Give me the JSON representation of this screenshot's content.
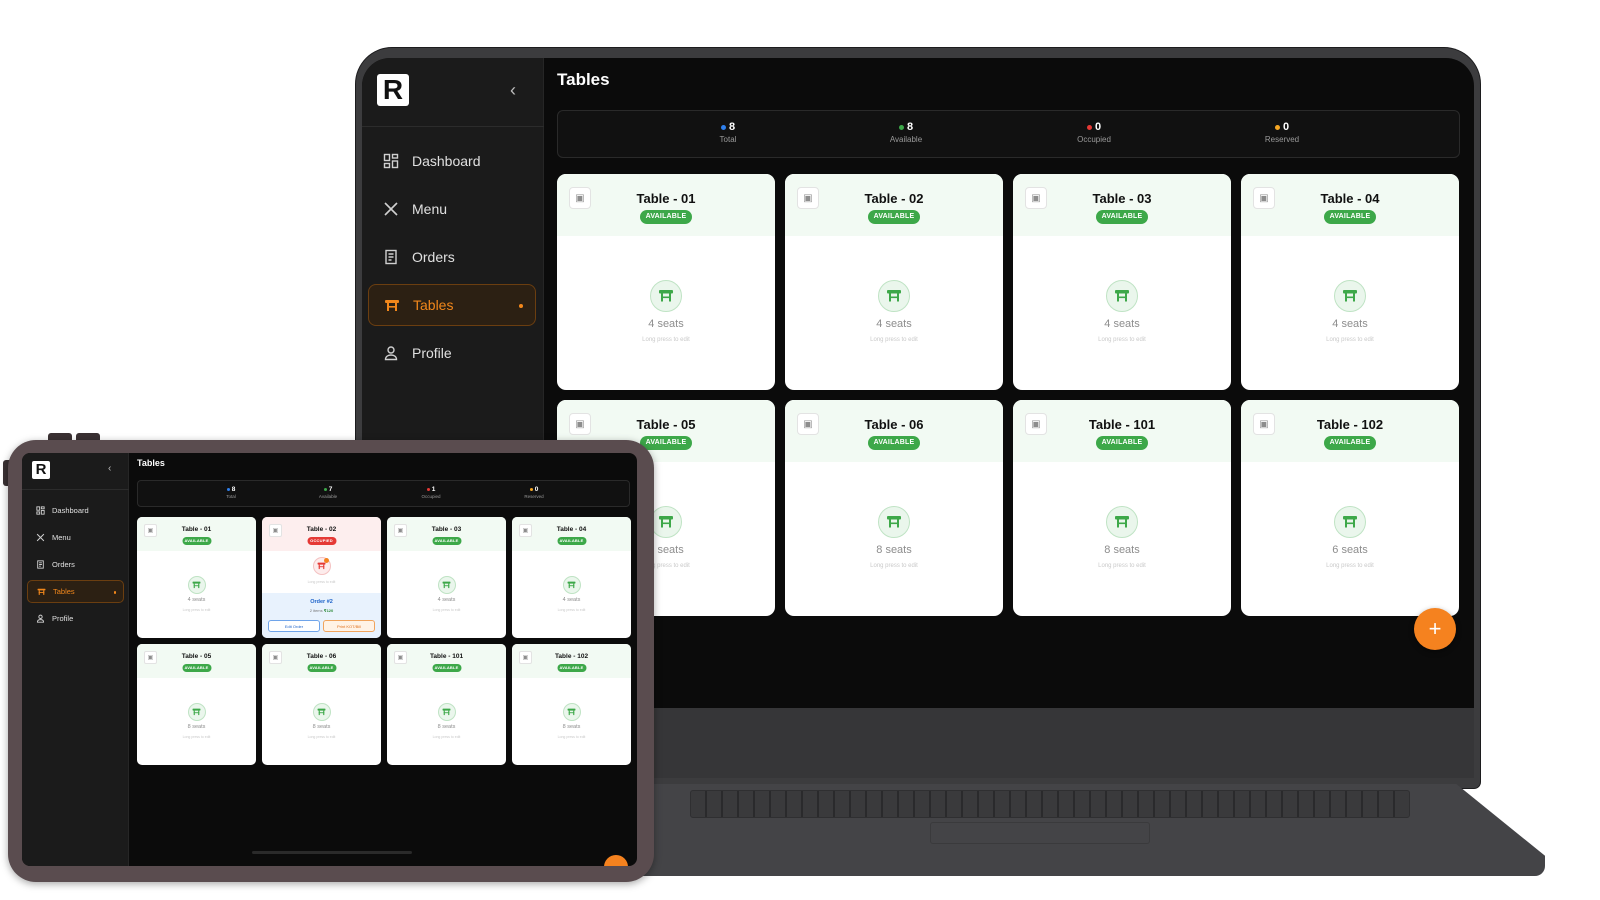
{
  "brand": {
    "logo_letter": "R",
    "accent": "#f5821f",
    "available_color": "#3da849",
    "occupied_color": "#e53935"
  },
  "laptop": {
    "sidebar": {
      "collapse_icon": "chevron-left-icon",
      "items": [
        {
          "label": "Dashboard",
          "icon": "grid-icon"
        },
        {
          "label": "Menu",
          "icon": "utensils-icon"
        },
        {
          "label": "Orders",
          "icon": "receipt-icon"
        },
        {
          "label": "Tables",
          "icon": "table-icon",
          "active": true
        },
        {
          "label": "Profile",
          "icon": "user-icon"
        }
      ]
    },
    "title": "Tables",
    "stats": [
      {
        "value": "8",
        "label": "Total",
        "color": "#2f80ed"
      },
      {
        "value": "8",
        "label": "Available",
        "color": "#3da849"
      },
      {
        "value": "0",
        "label": "Occupied",
        "color": "#e53935"
      },
      {
        "value": "0",
        "label": "Reserved",
        "color": "#f5a623"
      }
    ],
    "tables": [
      {
        "name": "Table - 01",
        "status": "AVAILABLE",
        "seats": "4 seats",
        "hint": "Long press to edit"
      },
      {
        "name": "Table - 02",
        "status": "AVAILABLE",
        "seats": "4 seats",
        "hint": "Long press to edit"
      },
      {
        "name": "Table - 03",
        "status": "AVAILABLE",
        "seats": "4 seats",
        "hint": "Long press to edit"
      },
      {
        "name": "Table - 04",
        "status": "AVAILABLE",
        "seats": "4 seats",
        "hint": "Long press to edit"
      },
      {
        "name": "Table - 05",
        "status": "AVAILABLE",
        "seats": "8 seats",
        "hint": "Long press to edit"
      },
      {
        "name": "Table - 06",
        "status": "AVAILABLE",
        "seats": "8 seats",
        "hint": "Long press to edit"
      },
      {
        "name": "Table - 101",
        "status": "AVAILABLE",
        "seats": "8 seats",
        "hint": "Long press to edit"
      },
      {
        "name": "Table - 102",
        "status": "AVAILABLE",
        "seats": "6 seats",
        "hint": "Long press to edit"
      }
    ],
    "fab_label": "+"
  },
  "tablet": {
    "sidebar": {
      "items": [
        {
          "label": "Dashboard"
        },
        {
          "label": "Menu"
        },
        {
          "label": "Orders"
        },
        {
          "label": "Tables",
          "active": true
        },
        {
          "label": "Profile"
        }
      ]
    },
    "title": "Tables",
    "stats": [
      {
        "value": "8",
        "label": "Total"
      },
      {
        "value": "7",
        "label": "Available"
      },
      {
        "value": "1",
        "label": "Occupied"
      },
      {
        "value": "0",
        "label": "Reserved"
      }
    ],
    "tables": [
      {
        "name": "Table - 01",
        "status": "AVAILABLE",
        "seats": "4 seats",
        "hint": "Long press to edit"
      },
      {
        "name": "Table - 02",
        "status": "OCCUPIED",
        "hint": "Long press to edit",
        "order": {
          "name": "Order #2",
          "items": "2 items",
          "amount": "₹120",
          "edit_label": "Edit Order",
          "kot_label": "Print KOT/Bill"
        }
      },
      {
        "name": "Table - 03",
        "status": "AVAILABLE",
        "seats": "4 seats",
        "hint": "Long press to edit"
      },
      {
        "name": "Table - 04",
        "status": "AVAILABLE",
        "seats": "4 seats",
        "hint": "Long press to edit"
      },
      {
        "name": "Table - 05",
        "status": "AVAILABLE",
        "seats": "8 seats",
        "hint": "Long press to edit"
      },
      {
        "name": "Table - 06",
        "status": "AVAILABLE",
        "seats": "8 seats",
        "hint": "Long press to edit"
      },
      {
        "name": "Table - 101",
        "status": "AVAILABLE",
        "seats": "8 seats",
        "hint": "Long press to edit"
      },
      {
        "name": "Table - 102",
        "status": "AVAILABLE",
        "seats": "8 seats",
        "hint": "Long press to edit"
      }
    ]
  }
}
